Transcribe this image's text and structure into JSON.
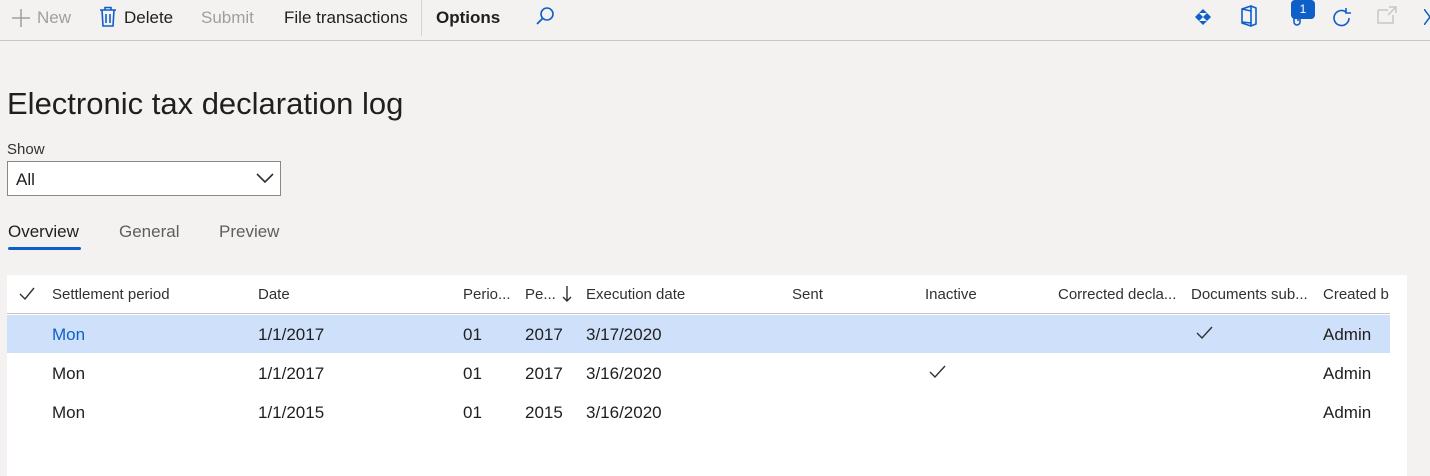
{
  "toolbar": {
    "new_label": "New",
    "delete_label": "Delete",
    "submit_label": "Submit",
    "file_transactions_label": "File transactions",
    "options_label": "Options",
    "attachments_count": "1"
  },
  "page": {
    "title": "Electronic tax declaration log",
    "show_label": "Show",
    "show_value": "All"
  },
  "tabs": [
    {
      "label": "Overview"
    },
    {
      "label": "General"
    },
    {
      "label": "Preview"
    }
  ],
  "grid": {
    "columns": [
      "Settlement period",
      "Date",
      "Perio...",
      "Pe...",
      "Execution date",
      "Sent",
      "Inactive",
      "Corrected decla...",
      "Documents sub...",
      "Created b"
    ],
    "rows": [
      {
        "settlement_period": "Mon",
        "date": "1/1/2017",
        "period": "01",
        "year": "2017",
        "execution_date": "3/17/2020",
        "inactive": false,
        "documents_submitted": true,
        "created_by": "Admin",
        "selected": true
      },
      {
        "settlement_period": "Mon",
        "date": "1/1/2017",
        "period": "01",
        "year": "2017",
        "execution_date": "3/16/2020",
        "inactive": true,
        "documents_submitted": false,
        "created_by": "Admin",
        "selected": false
      },
      {
        "settlement_period": "Mon",
        "date": "1/1/2015",
        "period": "01",
        "year": "2015",
        "execution_date": "3/16/2020",
        "inactive": false,
        "documents_submitted": false,
        "created_by": "Admin",
        "selected": false
      }
    ]
  },
  "colors": {
    "accent": "#0f5fc9",
    "selected_row": "#cfe0fb",
    "background": "#f3f2f1"
  }
}
